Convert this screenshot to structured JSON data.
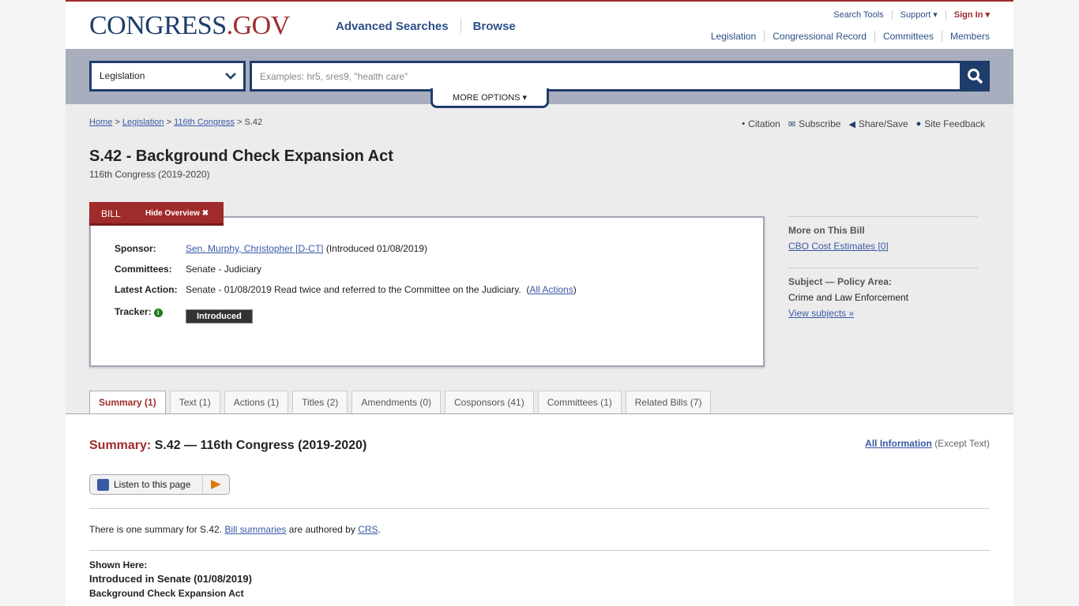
{
  "header": {
    "logo_main": "CONGRESS",
    "logo_suffix": ".GOV",
    "nav": [
      "Advanced Searches",
      "Browse"
    ],
    "util": {
      "search_tools": "Search Tools",
      "support": "Support ▾",
      "sign_in": "Sign In ▾"
    },
    "sections": [
      "Legislation",
      "Congressional Record",
      "Committees",
      "Members"
    ]
  },
  "search": {
    "collection": "Legislation",
    "placeholder": "Examples: hr5, sres9, \"health care\"",
    "more_options": "MORE OPTIONS ▾"
  },
  "breadcrumb": {
    "items": [
      "Home",
      "Legislation",
      "116th Congress"
    ],
    "current": "S.42",
    "sep": ">"
  },
  "page_actions": [
    "Citation",
    "Subscribe",
    "Share/Save",
    "Site Feedback"
  ],
  "bill": {
    "title": "S.42 - Background Check Expansion Act",
    "congress": "116th Congress (2019-2020)",
    "tab_label": "BILL",
    "hide_overview": "Hide Overview ✖",
    "sponsor_label": "Sponsor:",
    "sponsor_name": "Sen. Murphy, Christopher [D-CT]",
    "sponsor_intro": "(Introduced 01/08/2019)",
    "committees_label": "Committees:",
    "committees_value": "Senate - Judiciary",
    "latest_label": "Latest Action:",
    "latest_value": "Senate - 01/08/2019 Read twice and referred to the Committee on the Judiciary.",
    "all_actions": "All Actions",
    "tracker_label": "Tracker:",
    "tracker_status": "Introduced"
  },
  "more_on_bill": {
    "heading": "More on This Bill",
    "cbo": "CBO Cost Estimates [0]",
    "subject_heading": "Subject — Policy Area:",
    "subject_value": "Crime and Law Enforcement",
    "view_subjects": "View subjects »"
  },
  "tabs": [
    "Summary (1)",
    "Text (1)",
    "Actions (1)",
    "Titles (2)",
    "Amendments (0)",
    "Cosponsors (41)",
    "Committees (1)",
    "Related Bills (7)"
  ],
  "summary": {
    "label": "Summary:",
    "heading": "S.42 — 116th Congress (2019-2020)",
    "all_info": "All Information",
    "except_text": "(Except Text)",
    "listen": "Listen to this page",
    "note_prefix": "There is one summary for S.42.",
    "note_link1": "Bill summaries",
    "note_mid": "are authored by",
    "note_link2": "CRS",
    "note_end": ".",
    "shown_label": "Shown Here:",
    "shown_version": "Introduced in Senate (01/08/2019)",
    "shown_title": "Background Check Expansion Act"
  }
}
